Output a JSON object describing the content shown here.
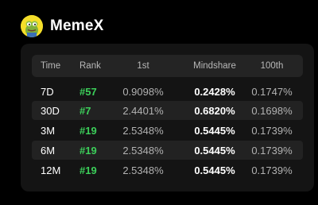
{
  "app": {
    "title": "MemeX",
    "avatar_icon": "pepe-avatar-icon",
    "avatar_color": "#f4de2a"
  },
  "colors": {
    "background": "#000000",
    "card": "#141414",
    "header_row": "#242424",
    "alt_row": "#222222",
    "rank": "#3ccf5a"
  },
  "table": {
    "headers": {
      "time": "Time",
      "rank": "Rank",
      "first": "1st",
      "mindshare": "Mindshare",
      "hundredth": "100th"
    },
    "rows": [
      {
        "time": "7D",
        "rank": "#57",
        "first": "0.9098%",
        "mindshare": "0.2428%",
        "hundredth": "0.1747%"
      },
      {
        "time": "30D",
        "rank": "#7",
        "first": "2.4401%",
        "mindshare": "0.6820%",
        "hundredth": "0.1698%"
      },
      {
        "time": "3M",
        "rank": "#19",
        "first": "2.5348%",
        "mindshare": "0.5445%",
        "hundredth": "0.1739%"
      },
      {
        "time": "6M",
        "rank": "#19",
        "first": "2.5348%",
        "mindshare": "0.5445%",
        "hundredth": "0.1739%"
      },
      {
        "time": "12M",
        "rank": "#19",
        "first": "2.5348%",
        "mindshare": "0.5445%",
        "hundredth": "0.1739%"
      }
    ]
  }
}
